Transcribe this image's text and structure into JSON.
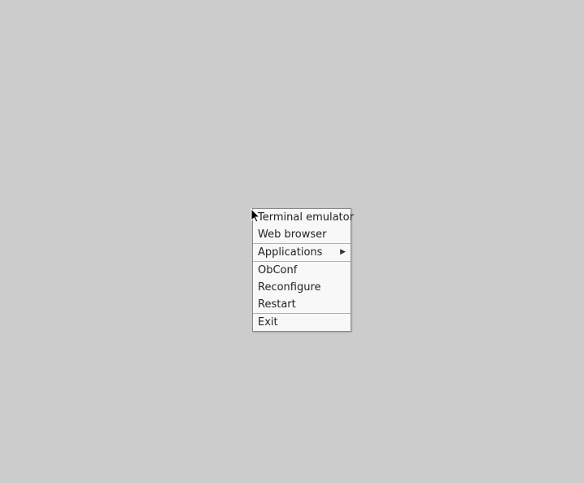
{
  "menu": {
    "sections": [
      {
        "items": [
          {
            "label": "Terminal emulator",
            "has_submenu": false
          },
          {
            "label": "Web browser",
            "has_submenu": false
          }
        ]
      },
      {
        "items": [
          {
            "label": "Applications",
            "has_submenu": true
          }
        ]
      },
      {
        "items": [
          {
            "label": "ObConf",
            "has_submenu": false
          },
          {
            "label": "Reconfigure",
            "has_submenu": false
          },
          {
            "label": "Restart",
            "has_submenu": false
          }
        ]
      },
      {
        "items": [
          {
            "label": "Exit",
            "has_submenu": false
          }
        ]
      }
    ]
  }
}
